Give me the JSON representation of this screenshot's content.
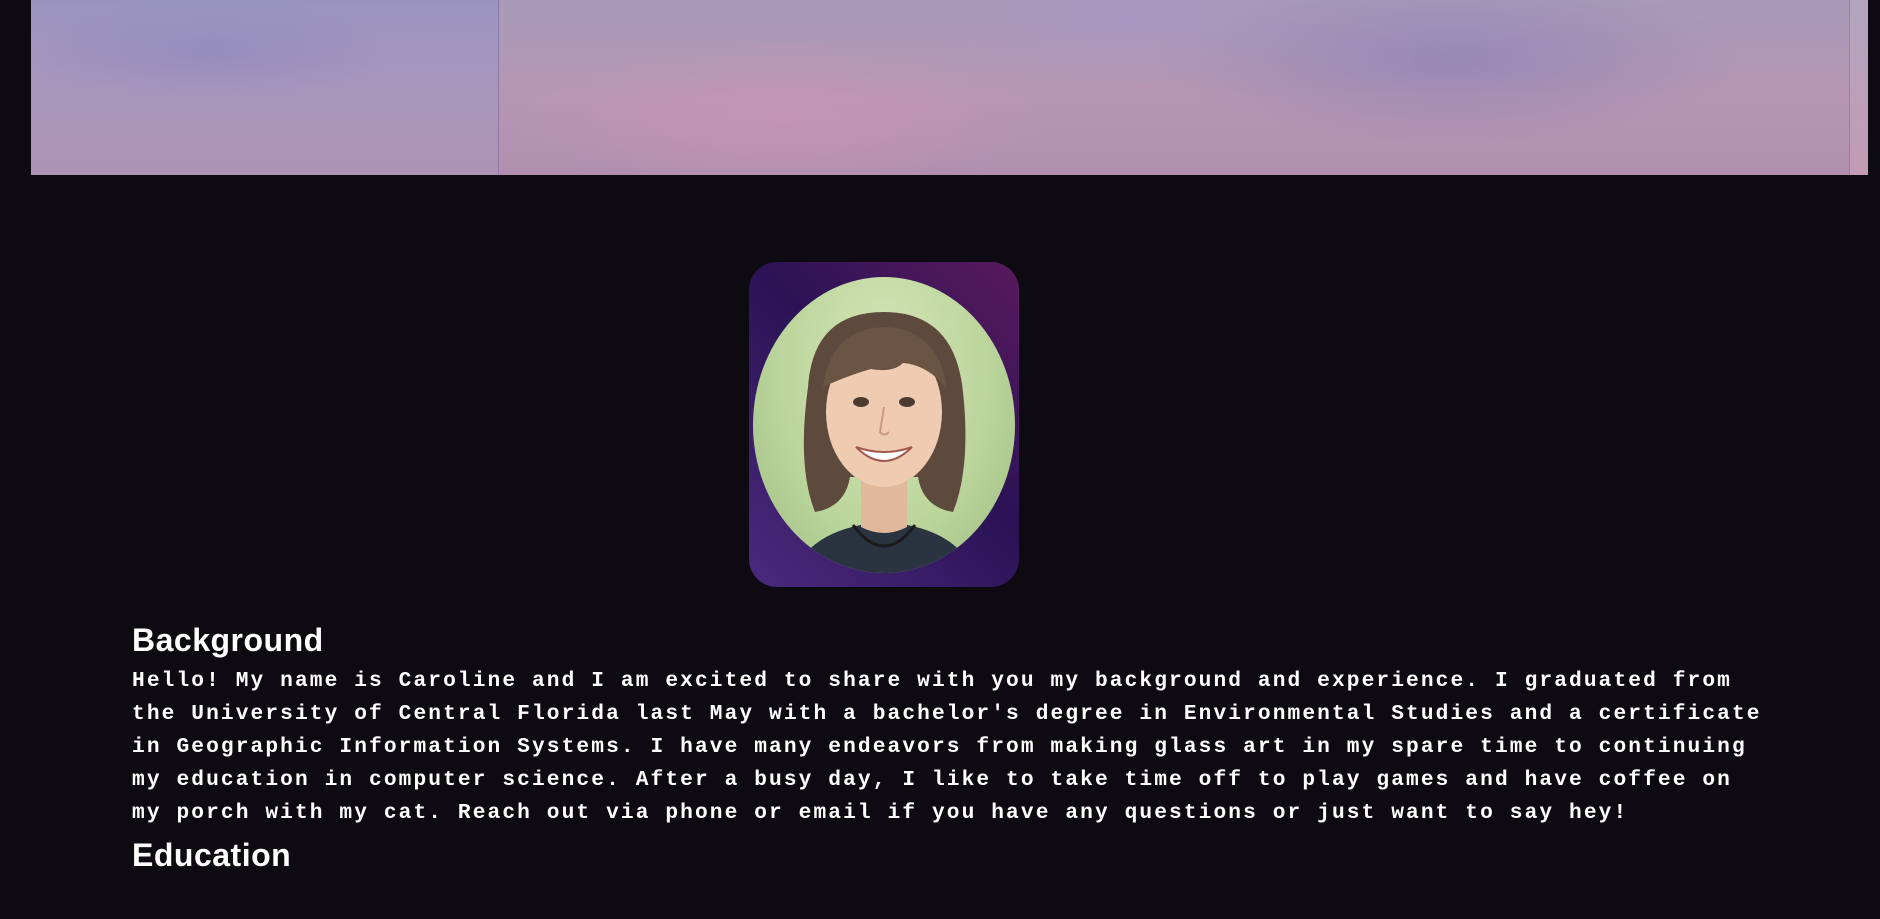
{
  "banner": {
    "alt": "header banner"
  },
  "profile": {
    "photo_alt": "profile photo"
  },
  "sections": {
    "background": {
      "heading": "Background",
      "body": "Hello! My name is Caroline and I am excited to share with you my background and experience. I graduated from the University of Central Florida last May with a bachelor's degree in Environmental Studies and a certificate in Geographic Information Systems. I have many endeavors from making glass art in my spare time to continuing my education in computer science. After a busy day, I like to take time off to play games and have coffee on my porch with my cat. Reach out via phone or email if you have any questions or just want to say hey!"
    },
    "education": {
      "heading": "Education"
    }
  }
}
